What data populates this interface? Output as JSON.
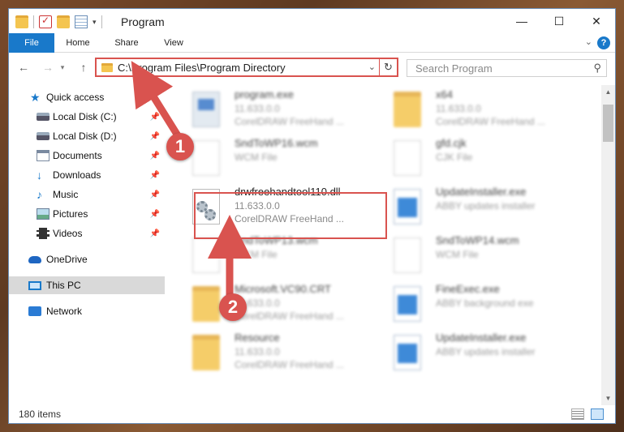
{
  "window": {
    "title": "Program"
  },
  "ribbon": {
    "tabs": [
      {
        "label": "File"
      },
      {
        "label": "Home"
      },
      {
        "label": "Share"
      },
      {
        "label": "View"
      }
    ]
  },
  "address": {
    "path": "C:\\Program Files\\Program Directory",
    "search_placeholder": "Search Program"
  },
  "navpane": {
    "items": [
      {
        "label": "Quick access",
        "icon": "star-icon",
        "pinned": false
      },
      {
        "label": "Local Disk (C:)",
        "icon": "disk-icon",
        "pinned": true
      },
      {
        "label": "Local Disk (D:)",
        "icon": "disk-icon",
        "pinned": true
      },
      {
        "label": "Documents",
        "icon": "documents-icon",
        "pinned": true
      },
      {
        "label": "Downloads",
        "icon": "downloads-icon",
        "pinned": true
      },
      {
        "label": "Music",
        "icon": "music-icon",
        "pinned": true
      },
      {
        "label": "Pictures",
        "icon": "pictures-icon",
        "pinned": true
      },
      {
        "label": "Videos",
        "icon": "videos-icon",
        "pinned": true
      },
      {
        "label": "OneDrive",
        "icon": "onedrive-icon",
        "pinned": false
      },
      {
        "label": "This PC",
        "icon": "this-pc-icon",
        "pinned": false,
        "selected": true
      },
      {
        "label": "Network",
        "icon": "network-icon",
        "pinned": false
      }
    ]
  },
  "files": [
    {
      "name": "program.exe",
      "line2": "11.633.0.0",
      "line3": "CorelDRAW FreeHand ...",
      "icon": "exe-icon"
    },
    {
      "name": "x64",
      "line2": "11.633.0.0",
      "line3": "CorelDRAW FreeHand ...",
      "icon": "folder-icon"
    },
    {
      "name": "SndToWP16.wcm",
      "line2": "WCM File",
      "line3": "",
      "icon": "file-icon"
    },
    {
      "name": "gfd.cjk",
      "line2": "CJK File",
      "line3": "",
      "icon": "file-icon"
    },
    {
      "name": "drwfreehandtool110.dll",
      "line2": "11.633.0.0",
      "line3": "CorelDRAW FreeHand ...",
      "icon": "dll-gear-icon",
      "highlighted": true
    },
    {
      "name": "UpdateInstaller.exe",
      "line2": "ABBY updates installer",
      "line3": "",
      "icon": "installer-icon"
    },
    {
      "name": "SndToWP13.wcm",
      "line2": "WCM File",
      "line3": "",
      "icon": "file-icon"
    },
    {
      "name": "SndToWP14.wcm",
      "line2": "WCM File",
      "line3": "",
      "icon": "file-icon"
    },
    {
      "name": "Microsoft.VC90.CRT",
      "line2": "11.633.0.0",
      "line3": "CorelDRAW FreeHand ...",
      "icon": "folder-icon"
    },
    {
      "name": "FineExec.exe",
      "line2": "ABBY background exe",
      "line3": "",
      "icon": "installer-icon"
    },
    {
      "name": "Resource",
      "line2": "11.633.0.0",
      "line3": "CorelDRAW FreeHand ...",
      "icon": "folder-icon"
    },
    {
      "name": "UpdateInstaller.exe",
      "line2": "ABBY updates installer",
      "line3": "",
      "icon": "installer-icon"
    }
  ],
  "status": {
    "item_count": "180 items"
  },
  "annotations": {
    "badge1": "1",
    "badge2": "2",
    "color": "#d9534f"
  }
}
